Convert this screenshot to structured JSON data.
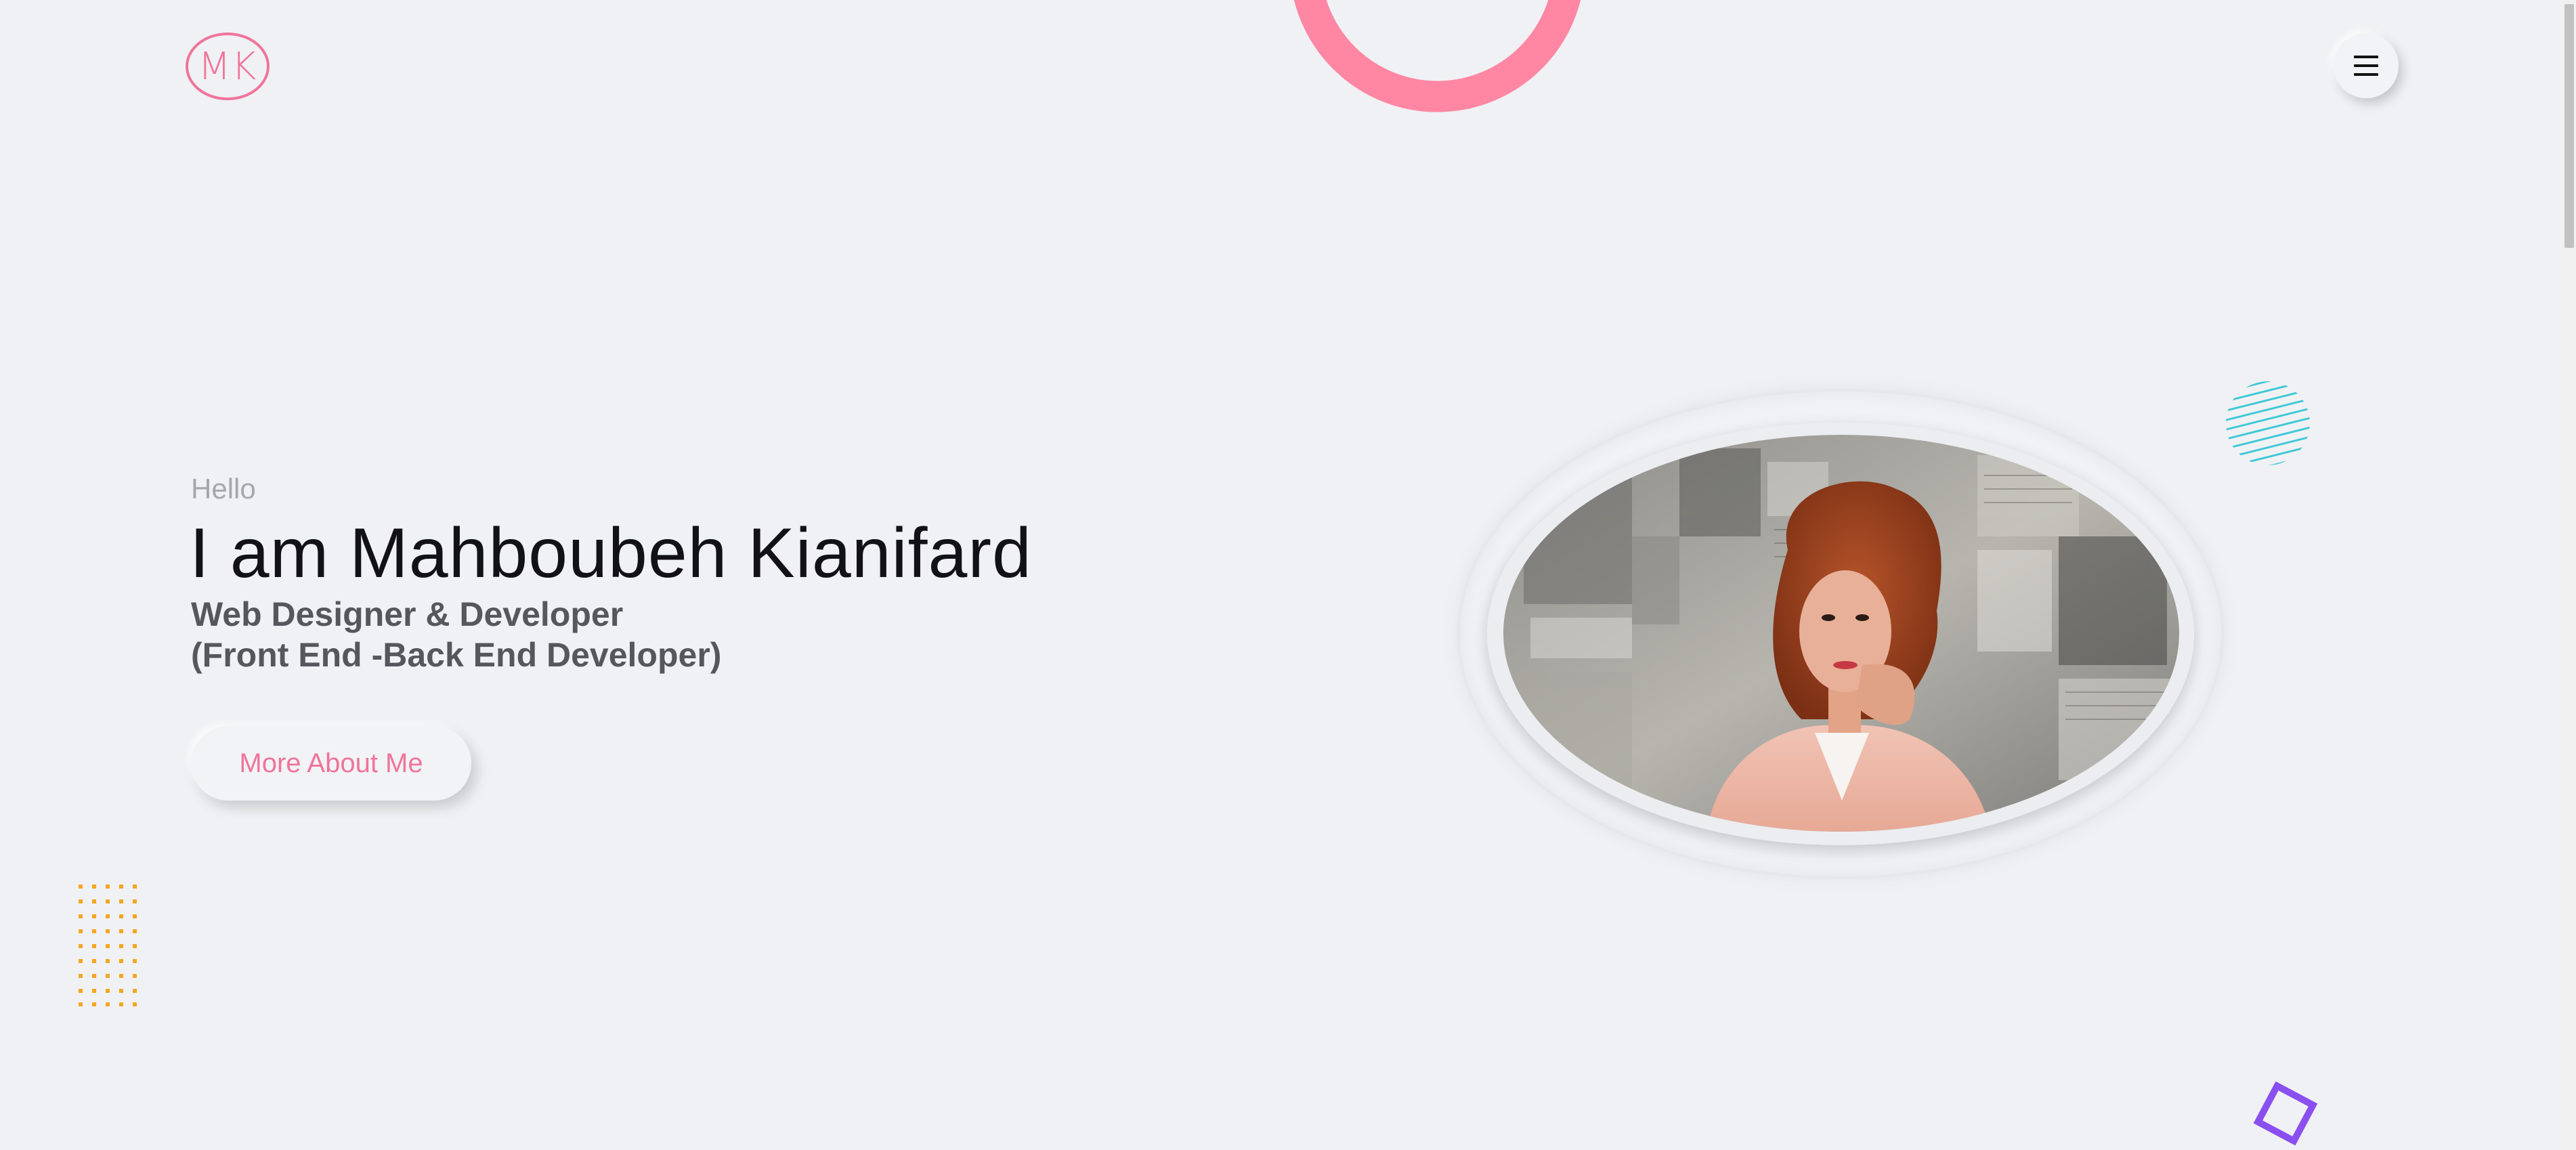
{
  "header": {
    "logo_text": "MK",
    "menu_icon": "hamburger-icon"
  },
  "hero": {
    "greeting": "Hello",
    "title": "I am Mahboubeh Kianifard",
    "subtitle_line1": "Web Designer & Developer",
    "subtitle_line2": "(Front End -Back End Developer)",
    "cta_label": "More About Me"
  },
  "colors": {
    "background": "#f0f1f4",
    "accent_pink": "#f0749a",
    "ring_pink": "#ff87a4",
    "dots_orange": "#f5a623",
    "stripe_cyan": "#3fc8d8",
    "diamond_purple": "#8a4ff0",
    "title_text": "#121216",
    "subtitle_text": "#55575d"
  },
  "decorations": {
    "top_ring": "ring-shape",
    "dot_grid": "dot-grid-shape",
    "striped_circle": "striped-circle-shape",
    "diamond": "diamond-outline-shape"
  },
  "portrait": {
    "subject": "portrait-photo"
  }
}
